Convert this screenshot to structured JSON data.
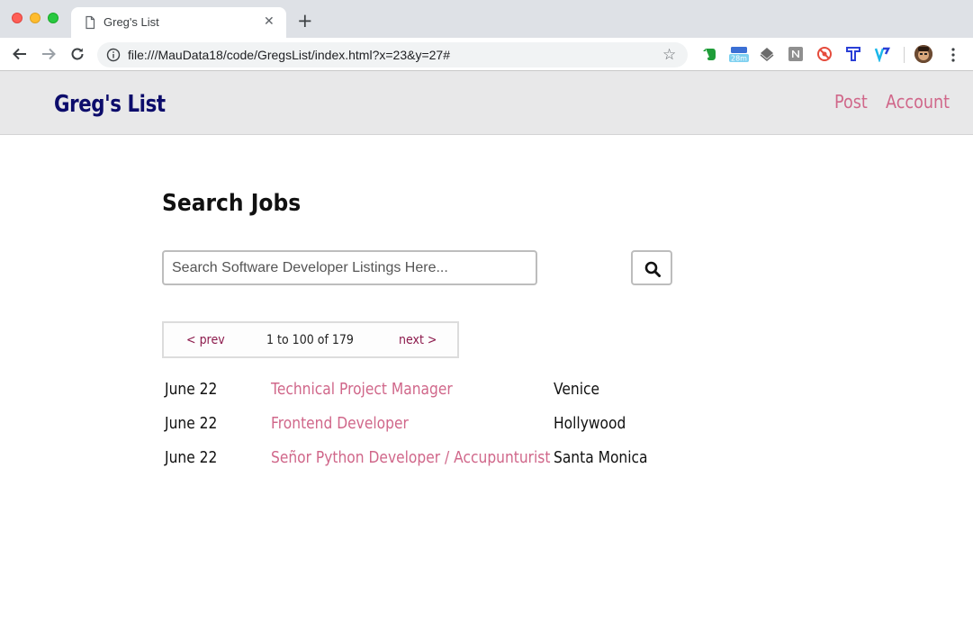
{
  "browser": {
    "tab_title": "Greg's List",
    "url": "file:///MauData18/code/GregsList/index.html?x=23&y=27#",
    "new_tab_symbol": "+",
    "close_tab_symbol": "✕",
    "extensions": [
      "evernote-icon",
      "calendar-badge-icon",
      "layers-icon",
      "notion-icon",
      "blocker-icon",
      "typewise-icon",
      "vimeo-icon"
    ],
    "extension_badge": "28m"
  },
  "header": {
    "logo": "Greg's List",
    "nav": {
      "post": "Post",
      "account": "Account"
    },
    "colors": {
      "logo": "#0c0c6b",
      "nav": "#d0678a",
      "background": "#e8e8e9"
    }
  },
  "main": {
    "heading": "Search Jobs",
    "search": {
      "placeholder": "Search Software Developer Listings Here...",
      "value": ""
    },
    "pager": {
      "prev": "< prev",
      "count": "1 to 100 of 179",
      "next": "next >"
    },
    "listings": [
      {
        "date": "June 22",
        "title": "Technical Project Manager",
        "location": "Venice"
      },
      {
        "date": "June 22",
        "title": "Frontend Developer",
        "location": "Hollywood"
      },
      {
        "date": "June 22",
        "title": "Señor Python Developer / Accupunturist",
        "location": "Santa Monica"
      }
    ]
  }
}
